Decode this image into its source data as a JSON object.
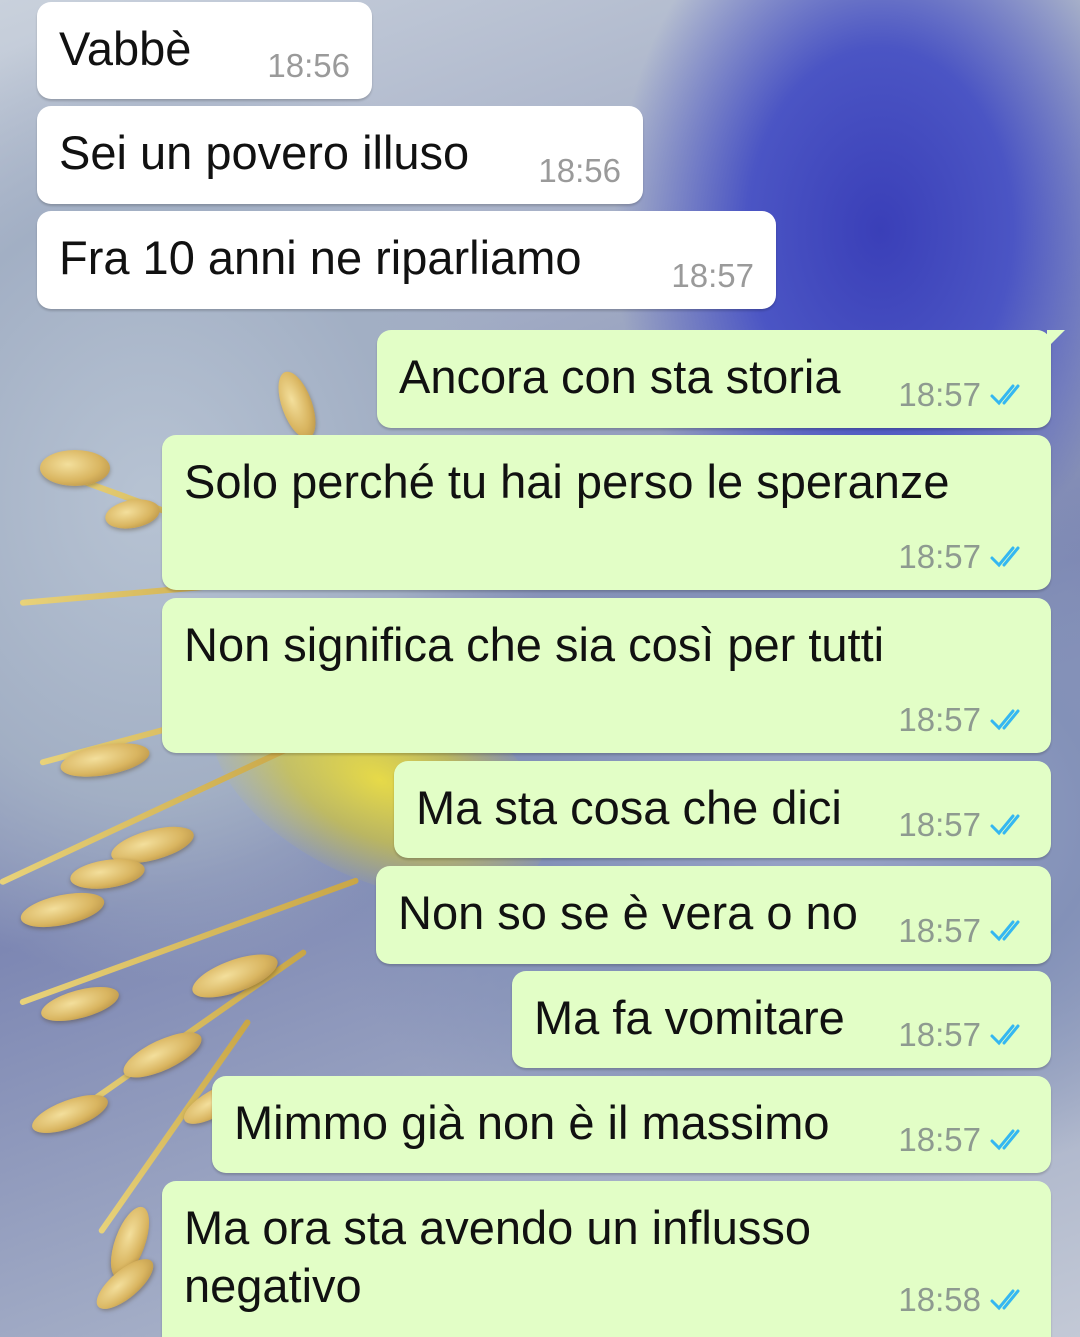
{
  "colors": {
    "incoming_bubble": "#ffffff",
    "outgoing_bubble": "#e2fec6",
    "timestamp": "#8e9a90",
    "read_ticks": "#34b7f1"
  },
  "wallpaper": {
    "description_icon": "flower-stamens-wallpaper"
  },
  "messages": [
    {
      "direction": "in",
      "text": "Vabbè",
      "time": "18:56"
    },
    {
      "direction": "in",
      "text": "Sei un povero illuso",
      "time": "18:56"
    },
    {
      "direction": "in",
      "text": "Fra 10 anni ne riparliamo",
      "time": "18:57"
    },
    {
      "direction": "out",
      "text": "Ancora con sta storia",
      "time": "18:57",
      "status": "read"
    },
    {
      "direction": "out",
      "text": "Solo perché tu hai perso le speranze",
      "time": "18:57",
      "status": "read"
    },
    {
      "direction": "out",
      "text": "Non significa che sia così per tutti",
      "time": "18:57",
      "status": "read"
    },
    {
      "direction": "out",
      "text": "Ma sta cosa che dici",
      "time": "18:57",
      "status": "read"
    },
    {
      "direction": "out",
      "text": "Non so se è vera o no",
      "time": "18:57",
      "status": "read"
    },
    {
      "direction": "out",
      "text": "Ma fa vomitare",
      "time": "18:57",
      "status": "read"
    },
    {
      "direction": "out",
      "text": "Mimmo già non è il massimo",
      "time": "18:57",
      "status": "read"
    },
    {
      "direction": "out",
      "text": "Ma ora sta avendo un influsso\nnegativo",
      "time": "18:58",
      "status": "read"
    }
  ]
}
